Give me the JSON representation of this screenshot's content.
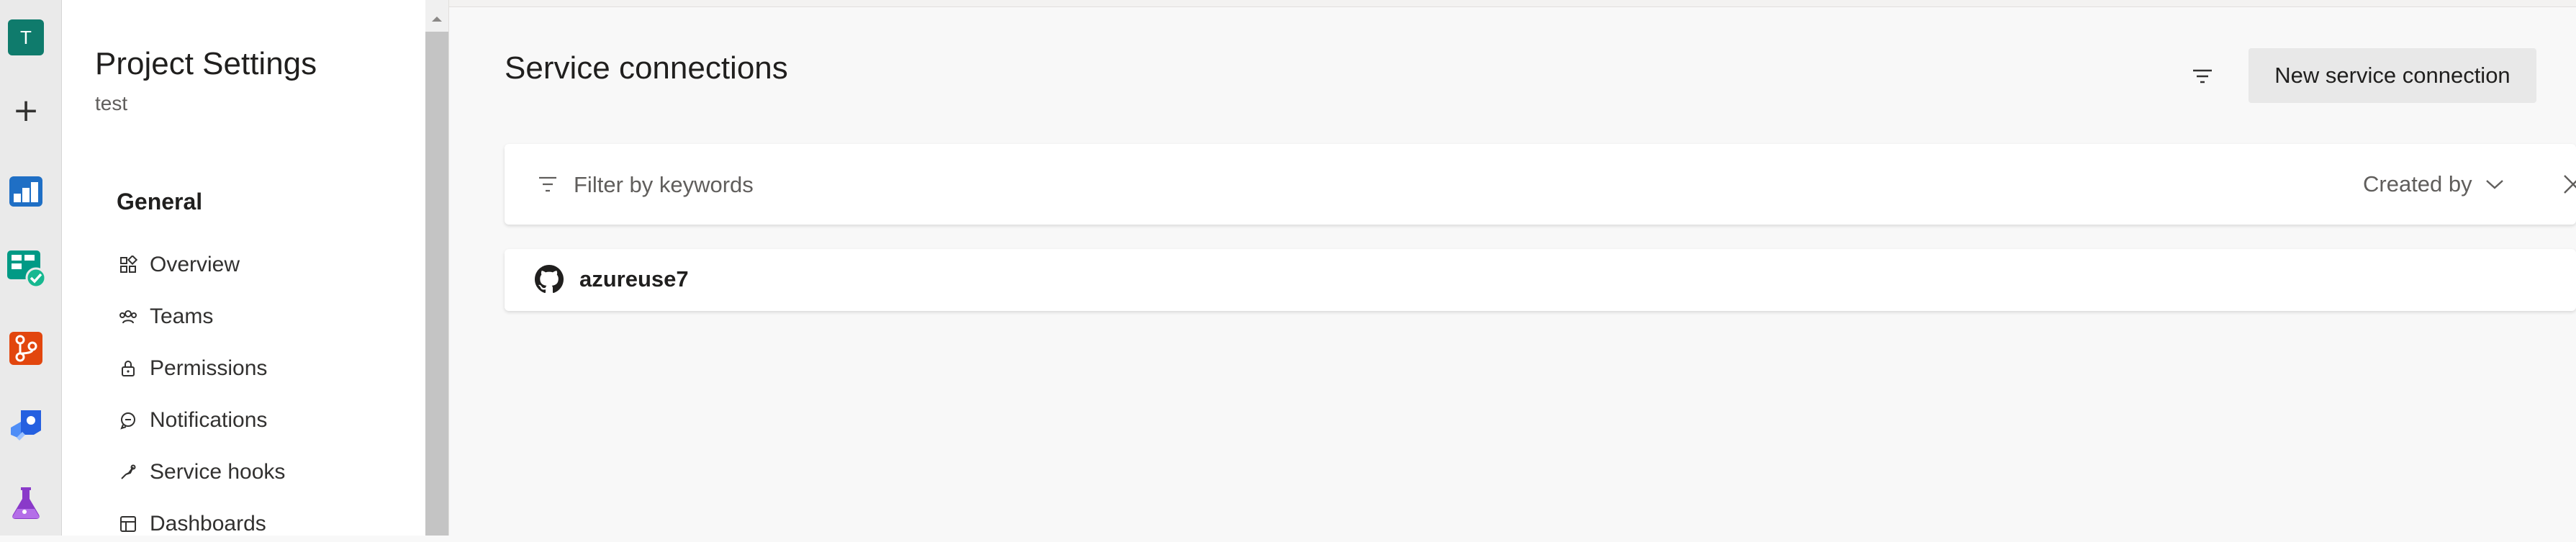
{
  "rail": {
    "project_initial": "T",
    "add_symbol": "+",
    "items": [
      {
        "name": "Overview",
        "icon": "azure-devops-overview-icon"
      },
      {
        "name": "Boards",
        "icon": "boards-icon"
      },
      {
        "name": "Repos",
        "icon": "repos-icon"
      },
      {
        "name": "Pipelines",
        "icon": "pipelines-icon"
      },
      {
        "name": "Test Plans",
        "icon": "test-plans-icon"
      }
    ]
  },
  "nav": {
    "title": "Project Settings",
    "subtitle": "test",
    "section": "General",
    "items": [
      {
        "label": "Overview",
        "icon": "overview-icon"
      },
      {
        "label": "Teams",
        "icon": "teams-icon"
      },
      {
        "label": "Permissions",
        "icon": "lock-icon"
      },
      {
        "label": "Notifications",
        "icon": "notifications-icon"
      },
      {
        "label": "Service hooks",
        "icon": "service-hooks-icon"
      },
      {
        "label": "Dashboards",
        "icon": "dashboards-icon"
      }
    ]
  },
  "main": {
    "title": "Service connections",
    "new_button": "New service connection",
    "filter": {
      "placeholder": "Filter by keywords",
      "created_by": "Created by"
    },
    "connections": [
      {
        "name": "azureuse7",
        "icon": "github-icon"
      }
    ]
  },
  "colors": {
    "accent": "#0078d4",
    "avatar": "#0f7b6c"
  }
}
